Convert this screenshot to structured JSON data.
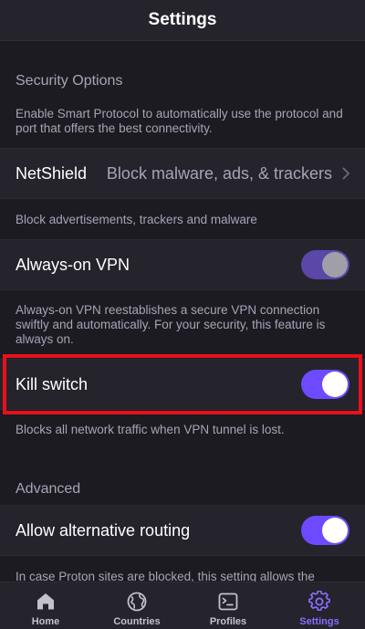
{
  "header": {
    "title": "Settings"
  },
  "security": {
    "section_title": "Security Options",
    "smart_protocol_desc": "Enable Smart Protocol to automatically use the protocol and port that offers the best connectivity.",
    "netshield": {
      "label": "NetShield",
      "value": "Block malware, ads, & trackers"
    },
    "netshield_desc": "Block advertisements, trackers and malware",
    "always_on": {
      "label": "Always-on VPN",
      "enabled": true,
      "locked": true
    },
    "always_on_desc": "Always-on VPN reestablishes a secure VPN connection swiftly and automatically. For your security, this feature is always on.",
    "kill_switch": {
      "label": "Kill switch",
      "enabled": true
    },
    "kill_switch_desc": "Blocks all network traffic when VPN tunnel is lost."
  },
  "advanced": {
    "section_title": "Advanced",
    "alt_routing": {
      "label": "Allow alternative routing",
      "enabled": true
    },
    "alt_routing_desc": "In case Proton sites are blocked, this setting allows the"
  },
  "tabbar": {
    "tabs": [
      {
        "label": "Home",
        "icon": "home-icon"
      },
      {
        "label": "Countries",
        "icon": "globe-icon"
      },
      {
        "label": "Profiles",
        "icon": "terminal-icon"
      },
      {
        "label": "Settings",
        "icon": "gear-icon",
        "active": true
      }
    ]
  },
  "colors": {
    "accent": "#6d4aff",
    "highlight": "#e8101a",
    "background": "#1c1b22",
    "row_background": "#25232c"
  }
}
